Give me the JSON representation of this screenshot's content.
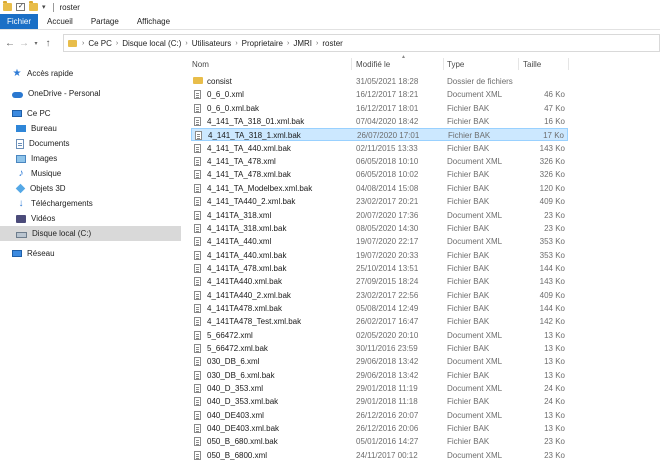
{
  "window": {
    "title": "roster"
  },
  "ribbon": {
    "tabs": [
      "Fichier",
      "Accueil",
      "Partage",
      "Affichage"
    ]
  },
  "address": {
    "crumbs": [
      "Ce PC",
      "Disque local (C:)",
      "Utilisateurs",
      "Proprietaire",
      "JMRI",
      "roster"
    ]
  },
  "nav": {
    "items": [
      {
        "label": "Accès rapide",
        "icon": "star-icon"
      },
      {
        "label": "OneDrive - Personal",
        "icon": "cloud-icon"
      },
      {
        "label": "Ce PC",
        "icon": "computer-icon"
      },
      {
        "label": "Bureau",
        "icon": "desktop-icon"
      },
      {
        "label": "Documents",
        "icon": "document-icon"
      },
      {
        "label": "Images",
        "icon": "pictures-icon"
      },
      {
        "label": "Musique",
        "icon": "music-icon"
      },
      {
        "label": "Objets 3D",
        "icon": "cube-icon"
      },
      {
        "label": "Téléchargements",
        "icon": "download-icon"
      },
      {
        "label": "Vidéos",
        "icon": "video-icon"
      },
      {
        "label": "Disque local (C:)",
        "icon": "drive-icon",
        "selected": true
      },
      {
        "label": "Réseau",
        "icon": "network-icon"
      }
    ]
  },
  "columns": {
    "name": "Nom",
    "date": "Modifié le",
    "type": "Type",
    "size": "Taille"
  },
  "files": [
    {
      "name": "consist",
      "date": "31/05/2021 18:28",
      "type": "Dossier de fichiers",
      "size": "",
      "folder": true
    },
    {
      "name": "0_6_0.xml",
      "date": "16/12/2017 18:21",
      "type": "Document XML",
      "size": "46 Ko"
    },
    {
      "name": "0_6_0.xml.bak",
      "date": "16/12/2017 18:01",
      "type": "Fichier BAK",
      "size": "47 Ko"
    },
    {
      "name": "4_141_TA_318_01.xml.bak",
      "date": "07/04/2020 18:42",
      "type": "Fichier BAK",
      "size": "16 Ko"
    },
    {
      "name": "4_141_TA_318_1.xml.bak",
      "date": "26/07/2020 17:01",
      "type": "Fichier BAK",
      "size": "17 Ko",
      "selected": true
    },
    {
      "name": "4_141_TA_440.xml.bak",
      "date": "02/11/2015 13:33",
      "type": "Fichier BAK",
      "size": "143 Ko"
    },
    {
      "name": "4_141_TA_478.xml",
      "date": "06/05/2018 10:10",
      "type": "Document XML",
      "size": "326 Ko"
    },
    {
      "name": "4_141_TA_478.xml.bak",
      "date": "06/05/2018 10:02",
      "type": "Fichier BAK",
      "size": "326 Ko"
    },
    {
      "name": "4_141_TA_Modelbex.xml.bak",
      "date": "04/08/2014 15:08",
      "type": "Fichier BAK",
      "size": "120 Ko"
    },
    {
      "name": "4_141_TA440_2.xml.bak",
      "date": "23/02/2017 20:21",
      "type": "Fichier BAK",
      "size": "409 Ko"
    },
    {
      "name": "4_141TA_318.xml",
      "date": "20/07/2020 17:36",
      "type": "Document XML",
      "size": "23 Ko"
    },
    {
      "name": "4_141TA_318.xml.bak",
      "date": "08/05/2020 14:30",
      "type": "Fichier BAK",
      "size": "23 Ko"
    },
    {
      "name": "4_141TA_440.xml",
      "date": "19/07/2020 22:17",
      "type": "Document XML",
      "size": "353 Ko"
    },
    {
      "name": "4_141TA_440.xml.bak",
      "date": "19/07/2020 20:33",
      "type": "Fichier BAK",
      "size": "353 Ko"
    },
    {
      "name": "4_141TA_478.xml.bak",
      "date": "25/10/2014 13:51",
      "type": "Fichier BAK",
      "size": "144 Ko"
    },
    {
      "name": "4_141TA440.xml.bak",
      "date": "27/09/2015 18:24",
      "type": "Fichier BAK",
      "size": "143 Ko"
    },
    {
      "name": "4_141TA440_2.xml.bak",
      "date": "23/02/2017 22:56",
      "type": "Fichier BAK",
      "size": "409 Ko"
    },
    {
      "name": "4_141TA478.xml.bak",
      "date": "05/08/2014 12:49",
      "type": "Fichier BAK",
      "size": "144 Ko"
    },
    {
      "name": "4_141TA478_Test.xml.bak",
      "date": "26/02/2017 16:47",
      "type": "Fichier BAK",
      "size": "142 Ko"
    },
    {
      "name": "5_66472.xml",
      "date": "02/05/2020 20:10",
      "type": "Document XML",
      "size": "13 Ko"
    },
    {
      "name": "5_66472.xml.bak",
      "date": "30/11/2016 23:59",
      "type": "Fichier BAK",
      "size": "13 Ko"
    },
    {
      "name": "030_DB_6.xml",
      "date": "29/06/2018 13:42",
      "type": "Document XML",
      "size": "13 Ko"
    },
    {
      "name": "030_DB_6.xml.bak",
      "date": "29/06/2018 13:42",
      "type": "Fichier BAK",
      "size": "13 Ko"
    },
    {
      "name": "040_D_353.xml",
      "date": "29/01/2018 11:19",
      "type": "Document XML",
      "size": "24 Ko"
    },
    {
      "name": "040_D_353.xml.bak",
      "date": "29/01/2018 11:18",
      "type": "Fichier BAK",
      "size": "24 Ko"
    },
    {
      "name": "040_DE403.xml",
      "date": "26/12/2016 20:07",
      "type": "Document XML",
      "size": "13 Ko"
    },
    {
      "name": "040_DE403.xml.bak",
      "date": "26/12/2016 20:06",
      "type": "Fichier BAK",
      "size": "13 Ko"
    },
    {
      "name": "050_B_680.xml.bak",
      "date": "05/01/2016 14:27",
      "type": "Fichier BAK",
      "size": "23 Ko"
    },
    {
      "name": "050_B_6800.xml",
      "date": "24/11/2017 00:12",
      "type": "Document XML",
      "size": "23 Ko"
    }
  ],
  "colors": {
    "accent": "#1a6fc6",
    "selection": "#cce8ff",
    "selection_border": "#99d1ff"
  }
}
